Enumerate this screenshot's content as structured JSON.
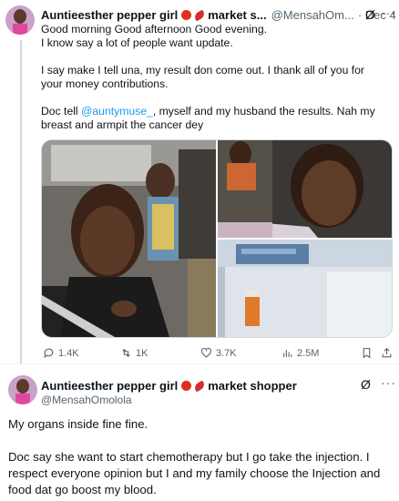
{
  "tweet1": {
    "author_name": "Auntieesther pepper girl",
    "author_suffix": "market s...",
    "handle": "@MensahOm...",
    "date": "· Dec 4",
    "grok_icon": "Ø",
    "more_icon": "···",
    "paragraphs": [
      "Good morning Good afternoon Good evening.",
      "I know say a lot of people want update."
    ],
    "paragraph2": "I say make I tell una, my result don come out. I thank all of you for your money contributions.",
    "paragraph3_pre": "Doc tell ",
    "mention": "@auntymuse_",
    "paragraph3_post": ", myself and my husband the results. Nah my breast and armpit the cancer dey",
    "stats": {
      "replies": "1.4K",
      "reposts": "1K",
      "likes": "3.7K",
      "views": "2.5M"
    }
  },
  "tweet2": {
    "author_name": "Auntieesther pepper girl",
    "author_suffix": "market shopper",
    "handle": "@MensahOmolola",
    "grok_icon": "Ø",
    "more_icon": "···",
    "paragraph1": "My organs inside fine fine.",
    "paragraph2": "Doc say she want to start chemotherapy but I go take the injection. I respect everyone opinion but I  and my family choose the Injection and food dat go boost my blood."
  },
  "colors": {
    "accent": "#1d9bf0",
    "secondary_text": "#536471",
    "primary_text": "#0f1419"
  }
}
